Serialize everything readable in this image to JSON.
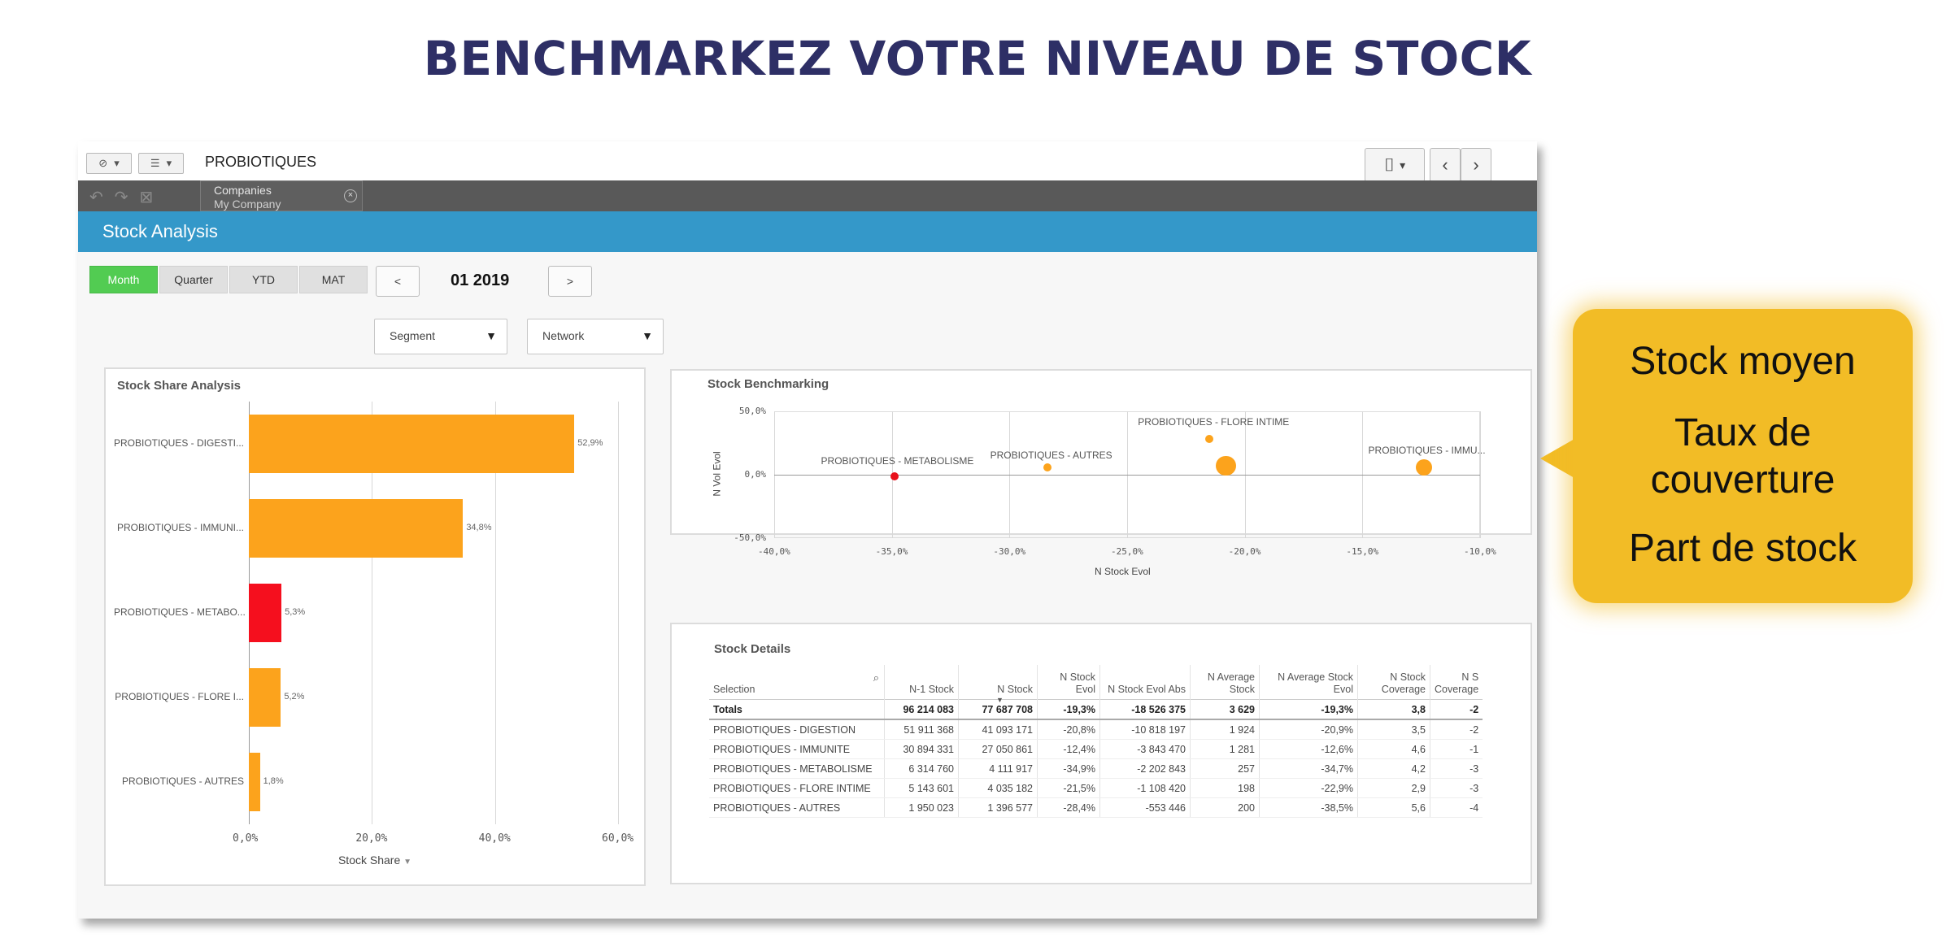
{
  "page_title": "BENCHMARKEZ VOTRE NIVEAU DE STOCK",
  "toolbar": {
    "app_name": "PROBIOTIQUES",
    "bookmark_icon": "bookmark-icon",
    "back_icon": "chevron-left-icon",
    "forward_icon": "chevron-right-icon"
  },
  "selections": {
    "field": "Companies",
    "value": "My Company"
  },
  "sheet": {
    "title": "Stock Analysis",
    "period_buttons": [
      "Month",
      "Quarter",
      "YTD",
      "MAT"
    ],
    "active_period": "Month",
    "prev_label": "<",
    "next_label": ">",
    "current_period": "01 2019",
    "segment_dropdown": "Segment",
    "network_dropdown": "Network"
  },
  "stock_share": {
    "title": "Stock Share Analysis",
    "x_label": "Stock Share"
  },
  "stock_benchmarking": {
    "title": "Stock Benchmarking"
  },
  "chart_data": [
    {
      "type": "bar",
      "orientation": "horizontal",
      "title": "Stock Share Analysis",
      "xlabel": "Stock Share",
      "categories": [
        "PROBIOTIQUES - DIGESTI...",
        "PROBIOTIQUES - IMMUNI...",
        "PROBIOTIQUES - METABO...",
        "PROBIOTIQUES - FLORE I...",
        "PROBIOTIQUES - AUTRES"
      ],
      "values": [
        52.9,
        34.8,
        5.3,
        5.2,
        1.8
      ],
      "value_labels": [
        "52,9%",
        "34,8%",
        "5,3%",
        "5,2%",
        "1,8%"
      ],
      "colors": [
        "#fca31c",
        "#fca31c",
        "#f50f1e",
        "#fca31c",
        "#fca31c"
      ],
      "xlim": [
        0,
        60
      ],
      "xticks": [
        "0,0%",
        "20,0%",
        "40,0%",
        "60,0%"
      ],
      "grid": true
    },
    {
      "type": "scatter",
      "title": "Stock Benchmarking",
      "xlabel": "N Stock Evol",
      "ylabel": "N Vol Evol",
      "xlim": [
        -40,
        -10
      ],
      "ylim": [
        -50,
        50
      ],
      "xticks": [
        "-40,0%",
        "-35,0%",
        "-30,0%",
        "-25,0%",
        "-20,0%",
        "-15,0%",
        "-10,0%"
      ],
      "yticks": [
        "50,0%",
        "0,0%",
        "-50,0%"
      ],
      "points": [
        {
          "label": "PROBIOTIQUES - METABOLISME",
          "x": -34.9,
          "y": -1,
          "size": 257,
          "color": "#e8111b"
        },
        {
          "label": "PROBIOTIQUES - AUTRES",
          "x": -28.4,
          "y": 6,
          "size": 200,
          "color": "#fca31c"
        },
        {
          "label": "PROBIOTIQUES - FLORE INTIME",
          "x": -21.5,
          "y": 28,
          "size": 198,
          "color": "#fca31c"
        },
        {
          "label": "",
          "x": -20.8,
          "y": 7,
          "size": 1924,
          "color": "#fca31c"
        },
        {
          "label": "PROBIOTIQUES - IMMU...",
          "x": -12.4,
          "y": 6,
          "size": 1281,
          "color": "#fca31c"
        }
      ],
      "grid": true
    }
  ],
  "stock_details": {
    "title": "Stock Details",
    "columns": [
      "Selection",
      "N-1 Stock",
      "N Stock",
      "N Stock Evol",
      "N Stock Evol Abs",
      "N Average Stock",
      "N Average Stock Evol",
      "N Stock Coverage",
      "N S Coverage"
    ],
    "totals": [
      "Totals",
      "96 214 083",
      "77 687 708",
      "-19,3%",
      "-18 526 375",
      "3 629",
      "-19,3%",
      "3,8",
      "-2"
    ],
    "rows": [
      [
        "PROBIOTIQUES - DIGESTION",
        "51 911 368",
        "41 093 171",
        "-20,8%",
        "-10 818 197",
        "1 924",
        "-20,9%",
        "3,5",
        "-2"
      ],
      [
        "PROBIOTIQUES - IMMUNITE",
        "30 894 331",
        "27 050 861",
        "-12,4%",
        "-3 843 470",
        "1 281",
        "-12,6%",
        "4,6",
        "-1"
      ],
      [
        "PROBIOTIQUES - METABOLISME",
        "6 314 760",
        "4 111 917",
        "-34,9%",
        "-2 202 843",
        "257",
        "-34,7%",
        "4,2",
        "-3"
      ],
      [
        "PROBIOTIQUES - FLORE INTIME",
        "5 143 601",
        "4 035 182",
        "-21,5%",
        "-1 108 420",
        "198",
        "-22,9%",
        "2,9",
        "-3"
      ],
      [
        "PROBIOTIQUES - AUTRES",
        "1 950 023",
        "1 396 577",
        "-28,4%",
        "-553 446",
        "200",
        "-38,5%",
        "5,6",
        "-4"
      ]
    ]
  },
  "callout": {
    "lines": [
      "Stock moyen",
      "Taux de",
      "couverture",
      "Part de stock"
    ],
    "color": "#f2bc26"
  }
}
